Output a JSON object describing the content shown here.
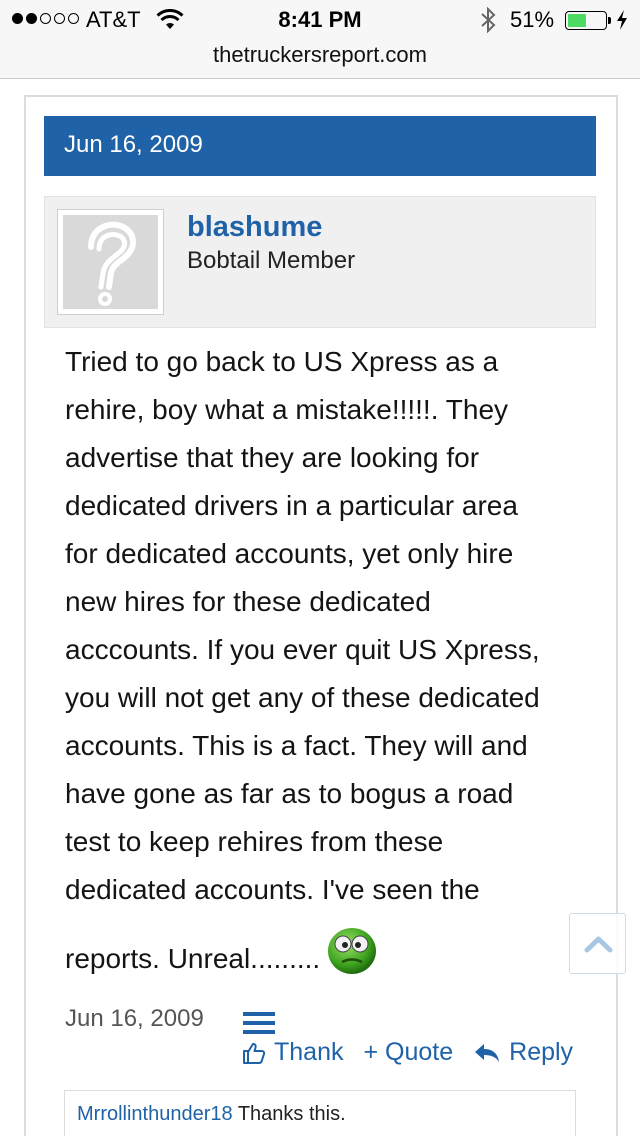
{
  "status_bar": {
    "carrier": "AT&T",
    "time": "8:41 PM",
    "battery": "51%"
  },
  "browser": {
    "url": "thetruckersreport.com"
  },
  "post": {
    "header_date": "Jun 16, 2009",
    "author": {
      "name": "blashume",
      "title": "Bobtail Member"
    },
    "message_lines": [
      "Tried to go back to US Xpress as a",
      "rehire, boy what a mistake!!!!!. They",
      "advertise that they are looking for",
      "dedicated drivers in a particular area",
      "for dedicated accounts, yet only hire",
      "new hires for these dedicated",
      "acccounts. If you ever quit US Xpress,",
      "you will not get any of these dedicated",
      "accounts. This is a fact. They will and",
      "have gone as far as to bogus a road",
      "test to keep rehires from these",
      "dedicated accounts. I've seen the",
      "reports. Unreal........."
    ],
    "footer_date": "Jun 16, 2009",
    "actions": {
      "thank": "Thank",
      "quote": "+ Quote",
      "reply": "Reply"
    },
    "likes": {
      "user": "Mrrollinthunder18",
      "suffix": " Thanks this."
    }
  },
  "icons": {
    "smiley": "green-sick-smiley-icon",
    "menu": "hamburger-menu-icon",
    "thank": "thumbs-up-icon",
    "reply": "reply-arrow-icon",
    "scroll_top": "chevron-up-icon"
  },
  "colors": {
    "accent": "#1f62a7",
    "header_bg": "#1f62a7",
    "userblock_bg": "#f0f0f0"
  }
}
